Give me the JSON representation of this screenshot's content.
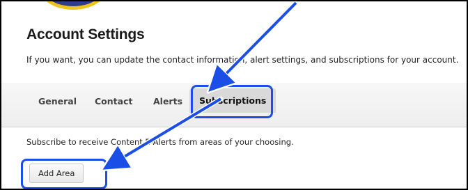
{
  "page": {
    "title": "Account Settings",
    "subtitle": "If you want, you can update the contact information, alert settings, and subscriptions for your account."
  },
  "tabs": [
    {
      "label": "General",
      "active": false
    },
    {
      "label": "Contact",
      "active": false
    },
    {
      "label": "Alerts",
      "active": false
    },
    {
      "label": "Subscriptions",
      "active": true
    }
  ],
  "subscriptions": {
    "description": "Subscribe to receive Content E-Alerts from areas of your choosing.",
    "add_area_label": "Add Area"
  },
  "annotations": {
    "highlight_color": "#1b4ee6",
    "arrow_color": "#1b4ee6"
  }
}
